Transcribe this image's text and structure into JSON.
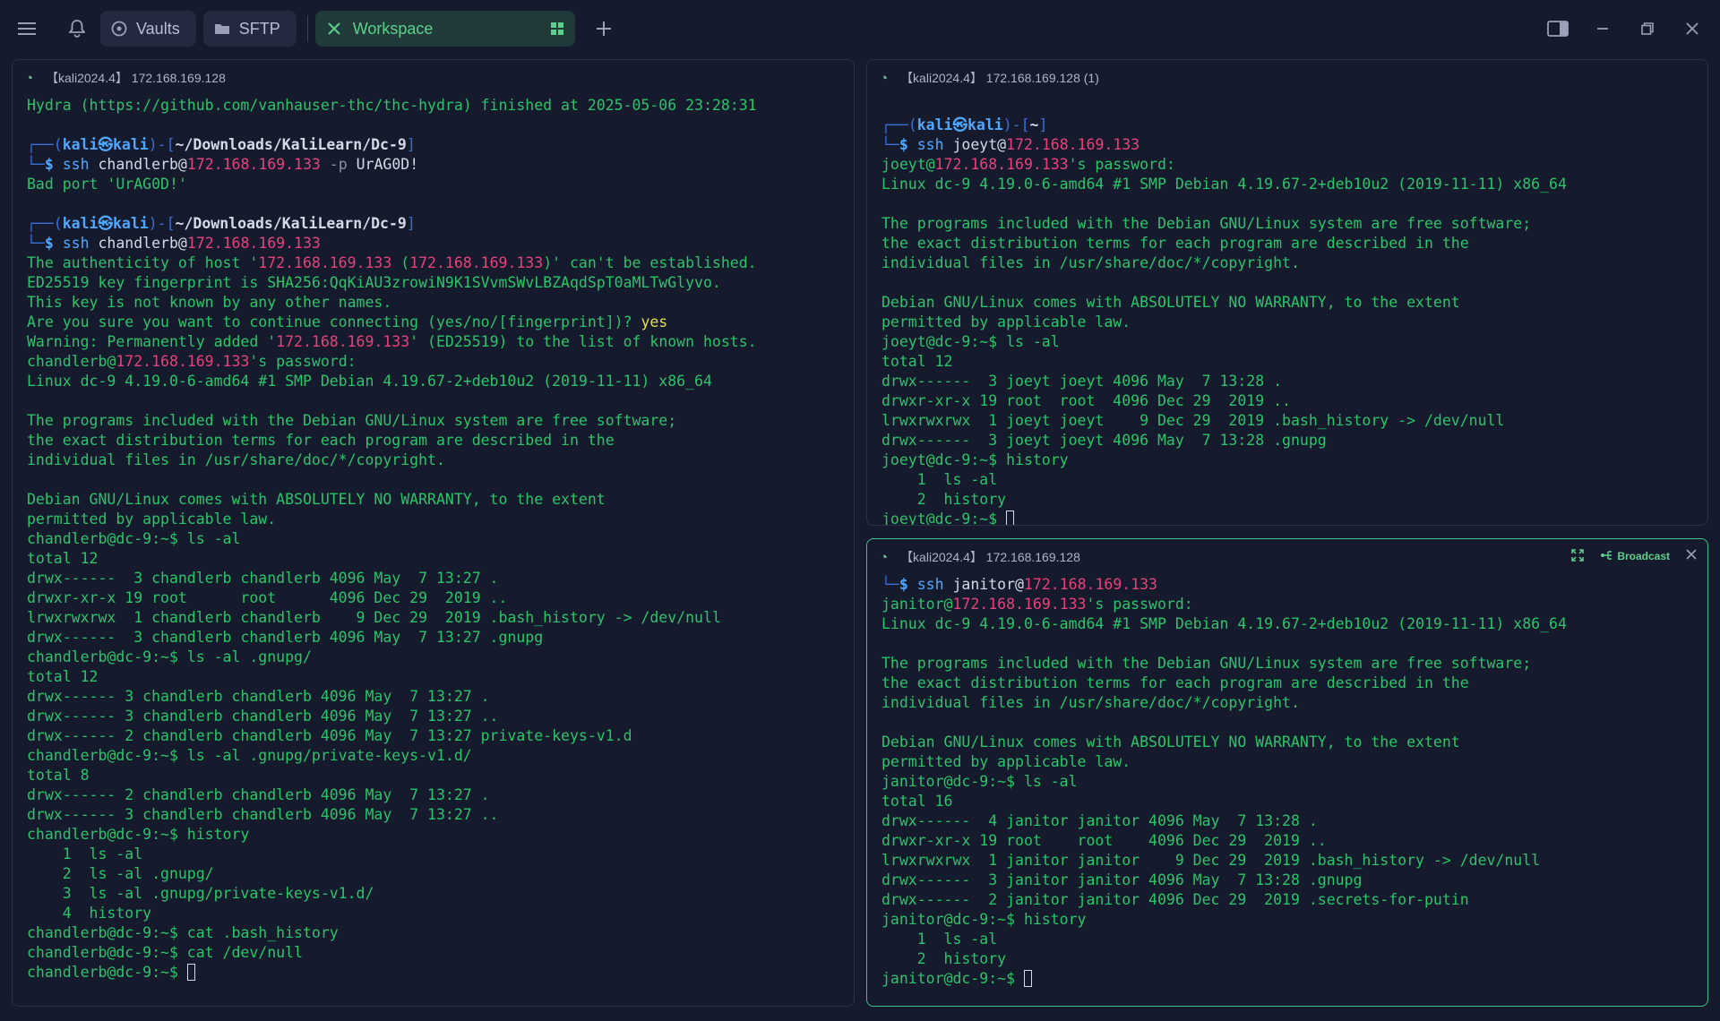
{
  "topbar": {
    "tabs": [
      {
        "label": "Vaults",
        "icon": "vault-icon"
      },
      {
        "label": "SFTP",
        "icon": "folder-icon"
      }
    ],
    "active_tab": {
      "label": "Workspace",
      "icon": "grid-icon"
    }
  },
  "panes": {
    "left": {
      "title": "【kali2024.4】 172.168.169.128",
      "lines": [
        [
          [
            "",
            "Hydra (https://github.com/vanhauser-thc/thc-hydra) finished at 2025-05-06 23:28:31"
          ]
        ],
        [
          [
            "",
            ""
          ]
        ],
        [
          [
            "pu",
            "┌──("
          ],
          [
            "usr",
            "kali㉿kali"
          ],
          [
            "pu",
            ")-["
          ],
          [
            "dir",
            "~/Downloads/KaliLearn/Dc-9"
          ],
          [
            "pu",
            "]"
          ]
        ],
        [
          [
            "pu",
            "└─"
          ],
          [
            "dollar",
            "$ "
          ],
          [
            "cmd",
            "ssh "
          ],
          [
            "arg",
            "chandlerb@"
          ],
          [
            "ip",
            "172.168.169.133"
          ],
          [
            "flag",
            " -p "
          ],
          [
            "arg",
            "UrAG0D!"
          ]
        ],
        [
          [
            "",
            "Bad port 'UrAG0D!'"
          ]
        ],
        [
          [
            "",
            ""
          ]
        ],
        [
          [
            "pu",
            "┌──("
          ],
          [
            "usr",
            "kali㉿kali"
          ],
          [
            "pu",
            ")-["
          ],
          [
            "dir",
            "~/Downloads/KaliLearn/Dc-9"
          ],
          [
            "pu",
            "]"
          ]
        ],
        [
          [
            "pu",
            "└─"
          ],
          [
            "dollar",
            "$ "
          ],
          [
            "cmd",
            "ssh "
          ],
          [
            "arg",
            "chandlerb@"
          ],
          [
            "ip",
            "172.168.169.133"
          ]
        ],
        [
          [
            "",
            "The authenticity of host '"
          ],
          [
            "ip",
            "172.168.169.133"
          ],
          [
            "",
            " ("
          ],
          [
            "ip",
            "172.168.169.133"
          ],
          [
            "",
            ")' can't be established."
          ]
        ],
        [
          [
            "",
            "ED25519 key fingerprint is SHA256:QqKiAU3zrowiN9K1SVvmSWvLBZAqdSpT0aMLTwGlyvo."
          ]
        ],
        [
          [
            "",
            "This key is not known by any other names."
          ]
        ],
        [
          [
            "",
            "Are you sure you want to continue connecting (yes/no/[fingerprint])? "
          ],
          [
            "yes",
            "yes"
          ]
        ],
        [
          [
            "",
            "Warning: Permanently added '"
          ],
          [
            "ip",
            "172.168.169.133"
          ],
          [
            "",
            "' (ED25519) to the list of known hosts."
          ]
        ],
        [
          [
            "",
            "chandlerb@"
          ],
          [
            "ip",
            "172.168.169.133"
          ],
          [
            "",
            "'s password:"
          ]
        ],
        [
          [
            "",
            "Linux dc-9 4.19.0-6-amd64 #1 SMP Debian 4.19.67-2+deb10u2 (2019-11-11) x86_64"
          ]
        ],
        [
          [
            "",
            ""
          ]
        ],
        [
          [
            "",
            "The programs included with the Debian GNU/Linux system are free software;"
          ]
        ],
        [
          [
            "",
            "the exact distribution terms for each program are described in the"
          ]
        ],
        [
          [
            "",
            "individual files in /usr/share/doc/*/copyright."
          ]
        ],
        [
          [
            "",
            ""
          ]
        ],
        [
          [
            "",
            "Debian GNU/Linux comes with ABSOLUTELY NO WARRANTY, to the extent"
          ]
        ],
        [
          [
            "",
            "permitted by applicable law."
          ]
        ],
        [
          [
            "",
            "chandlerb@dc-9:~$ ls -al"
          ]
        ],
        [
          [
            "",
            "total 12"
          ]
        ],
        [
          [
            "",
            "drwx------  3 chandlerb chandlerb 4096 May  7 13:27 ."
          ]
        ],
        [
          [
            "",
            "drwxr-xr-x 19 root      root      4096 Dec 29  2019 .."
          ]
        ],
        [
          [
            "",
            "lrwxrwxrwx  1 chandlerb chandlerb    9 Dec 29  2019 .bash_history -> /dev/null"
          ]
        ],
        [
          [
            "",
            "drwx------  3 chandlerb chandlerb 4096 May  7 13:27 .gnupg"
          ]
        ],
        [
          [
            "",
            "chandlerb@dc-9:~$ ls -al .gnupg/"
          ]
        ],
        [
          [
            "",
            "total 12"
          ]
        ],
        [
          [
            "",
            "drwx------ 3 chandlerb chandlerb 4096 May  7 13:27 ."
          ]
        ],
        [
          [
            "",
            "drwx------ 3 chandlerb chandlerb 4096 May  7 13:27 .."
          ]
        ],
        [
          [
            "",
            "drwx------ 2 chandlerb chandlerb 4096 May  7 13:27 private-keys-v1.d"
          ]
        ],
        [
          [
            "",
            "chandlerb@dc-9:~$ ls -al .gnupg/private-keys-v1.d/"
          ]
        ],
        [
          [
            "",
            "total 8"
          ]
        ],
        [
          [
            "",
            "drwx------ 2 chandlerb chandlerb 4096 May  7 13:27 ."
          ]
        ],
        [
          [
            "",
            "drwx------ 3 chandlerb chandlerb 4096 May  7 13:27 .."
          ]
        ],
        [
          [
            "",
            "chandlerb@dc-9:~$ history"
          ]
        ],
        [
          [
            "",
            "    1  ls -al"
          ]
        ],
        [
          [
            "",
            "    2  ls -al .gnupg/"
          ]
        ],
        [
          [
            "",
            "    3  ls -al .gnupg/private-keys-v1.d/"
          ]
        ],
        [
          [
            "",
            "    4  history"
          ]
        ],
        [
          [
            "",
            "chandlerb@dc-9:~$ cat .bash_history"
          ]
        ],
        [
          [
            "",
            "chandlerb@dc-9:~$ cat /dev/null"
          ]
        ],
        [
          [
            "",
            "chandlerb@dc-9:~$ "
          ],
          [
            "cursor",
            ""
          ]
        ]
      ]
    },
    "top_right": {
      "title": "【kali2024.4】 172.168.169.128 (1)",
      "lines": [
        [
          [
            "",
            ""
          ]
        ],
        [
          [
            "pu",
            "┌──("
          ],
          [
            "usr",
            "kali㉿kali"
          ],
          [
            "pu",
            ")-["
          ],
          [
            "dir",
            "~"
          ],
          [
            "pu",
            "]"
          ]
        ],
        [
          [
            "pu",
            "└─"
          ],
          [
            "dollar",
            "$ "
          ],
          [
            "cmd",
            "ssh "
          ],
          [
            "arg",
            "joeyt@"
          ],
          [
            "ip",
            "172.168.169.133"
          ]
        ],
        [
          [
            "",
            "joeyt@"
          ],
          [
            "ip",
            "172.168.169.133"
          ],
          [
            "",
            "'s password:"
          ]
        ],
        [
          [
            "",
            "Linux dc-9 4.19.0-6-amd64 #1 SMP Debian 4.19.67-2+deb10u2 (2019-11-11) x86_64"
          ]
        ],
        [
          [
            "",
            ""
          ]
        ],
        [
          [
            "",
            "The programs included with the Debian GNU/Linux system are free software;"
          ]
        ],
        [
          [
            "",
            "the exact distribution terms for each program are described in the"
          ]
        ],
        [
          [
            "",
            "individual files in /usr/share/doc/*/copyright."
          ]
        ],
        [
          [
            "",
            ""
          ]
        ],
        [
          [
            "",
            "Debian GNU/Linux comes with ABSOLUTELY NO WARRANTY, to the extent"
          ]
        ],
        [
          [
            "",
            "permitted by applicable law."
          ]
        ],
        [
          [
            "",
            "joeyt@dc-9:~$ ls -al"
          ]
        ],
        [
          [
            "",
            "total 12"
          ]
        ],
        [
          [
            "",
            "drwx------  3 joeyt joeyt 4096 May  7 13:28 ."
          ]
        ],
        [
          [
            "",
            "drwxr-xr-x 19 root  root  4096 Dec 29  2019 .."
          ]
        ],
        [
          [
            "",
            "lrwxrwxrwx  1 joeyt joeyt    9 Dec 29  2019 .bash_history -> /dev/null"
          ]
        ],
        [
          [
            "",
            "drwx------  3 joeyt joeyt 4096 May  7 13:28 .gnupg"
          ]
        ],
        [
          [
            "",
            "joeyt@dc-9:~$ history"
          ]
        ],
        [
          [
            "",
            "    1  ls -al"
          ]
        ],
        [
          [
            "",
            "    2  history"
          ]
        ],
        [
          [
            "",
            "joeyt@dc-9:~$ "
          ],
          [
            "cursor",
            ""
          ]
        ]
      ]
    },
    "bottom_right": {
      "title": "【kali2024.4】 172.168.169.128",
      "broadcast_label": "Broadcast",
      "lines": [
        [
          [
            "pu",
            "└─"
          ],
          [
            "dollar",
            "$ "
          ],
          [
            "cmd",
            "ssh "
          ],
          [
            "arg",
            "janitor@"
          ],
          [
            "ip",
            "172.168.169.133"
          ]
        ],
        [
          [
            "",
            "janitor@"
          ],
          [
            "ip",
            "172.168.169.133"
          ],
          [
            "",
            "'s password:"
          ]
        ],
        [
          [
            "",
            "Linux dc-9 4.19.0-6-amd64 #1 SMP Debian 4.19.67-2+deb10u2 (2019-11-11) x86_64"
          ]
        ],
        [
          [
            "",
            ""
          ]
        ],
        [
          [
            "",
            "The programs included with the Debian GNU/Linux system are free software;"
          ]
        ],
        [
          [
            "",
            "the exact distribution terms for each program are described in the"
          ]
        ],
        [
          [
            "",
            "individual files in /usr/share/doc/*/copyright."
          ]
        ],
        [
          [
            "",
            ""
          ]
        ],
        [
          [
            "",
            "Debian GNU/Linux comes with ABSOLUTELY NO WARRANTY, to the extent"
          ]
        ],
        [
          [
            "",
            "permitted by applicable law."
          ]
        ],
        [
          [
            "",
            "janitor@dc-9:~$ ls -al"
          ]
        ],
        [
          [
            "",
            "total 16"
          ]
        ],
        [
          [
            "",
            "drwx------  4 janitor janitor 4096 May  7 13:28 ."
          ]
        ],
        [
          [
            "",
            "drwxr-xr-x 19 root    root    4096 Dec 29  2019 .."
          ]
        ],
        [
          [
            "",
            "lrwxrwxrwx  1 janitor janitor    9 Dec 29  2019 .bash_history -> /dev/null"
          ]
        ],
        [
          [
            "",
            "drwx------  3 janitor janitor 4096 May  7 13:28 .gnupg"
          ]
        ],
        [
          [
            "",
            "drwx------  2 janitor janitor 4096 Dec 29  2019 .secrets-for-putin"
          ]
        ],
        [
          [
            "",
            "janitor@dc-9:~$ history"
          ]
        ],
        [
          [
            "",
            "    1  ls -al"
          ]
        ],
        [
          [
            "",
            "    2  history"
          ]
        ],
        [
          [
            "",
            "janitor@dc-9:~$ "
          ],
          [
            "cursor",
            ""
          ]
        ]
      ]
    }
  },
  "colors": {
    "background": "#151a2c",
    "terminal_text": "#2bc46a",
    "ip": "#e8427c",
    "command": "#4fa8ff",
    "accent": "#3fbf8a"
  }
}
